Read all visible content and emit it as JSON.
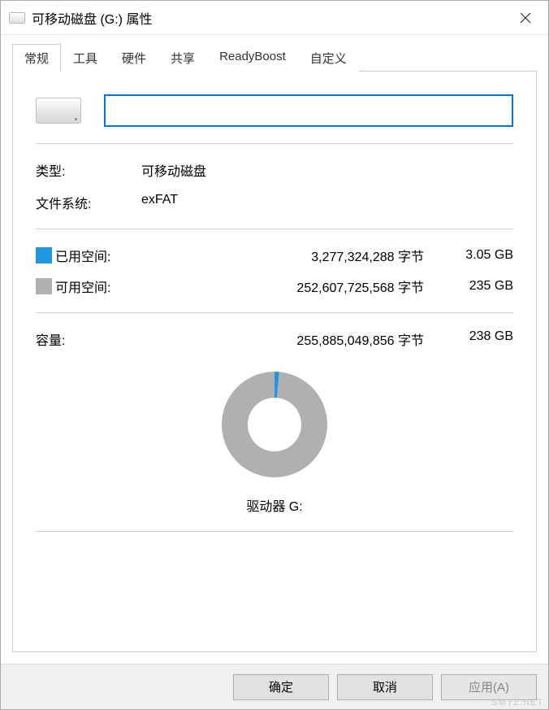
{
  "title": "可移动磁盘 (G:) 属性",
  "tabs": [
    {
      "label": "常规"
    },
    {
      "label": "工具"
    },
    {
      "label": "硬件"
    },
    {
      "label": "共享"
    },
    {
      "label": "ReadyBoost"
    },
    {
      "label": "自定义"
    }
  ],
  "general": {
    "name_value": "",
    "type_label": "类型:",
    "type_value": "可移动磁盘",
    "fs_label": "文件系统:",
    "fs_value": "exFAT",
    "used_label": "已用空间:",
    "used_bytes": "3,277,324,288 字节",
    "used_gb": "3.05 GB",
    "free_label": "可用空间:",
    "free_bytes": "252,607,725,568 字节",
    "free_gb": "235 GB",
    "capacity_label": "容量:",
    "capacity_bytes": "255,885,049,856 字节",
    "capacity_gb": "238 GB",
    "drive_label": "驱动器 G:"
  },
  "buttons": {
    "ok": "确定",
    "cancel": "取消",
    "apply": "应用(A)"
  },
  "chart_data": {
    "type": "pie",
    "title": "驱动器 G:",
    "series": [
      {
        "name": "已用空间",
        "value": 3277324288,
        "display": "3.05 GB",
        "color": "#2196e3"
      },
      {
        "name": "可用空间",
        "value": 252607725568,
        "display": "235 GB",
        "color": "#b0b0b0"
      }
    ],
    "total": {
      "name": "容量",
      "value": 255885049856,
      "display": "238 GB"
    }
  },
  "watermark": "SMYZ.NET"
}
